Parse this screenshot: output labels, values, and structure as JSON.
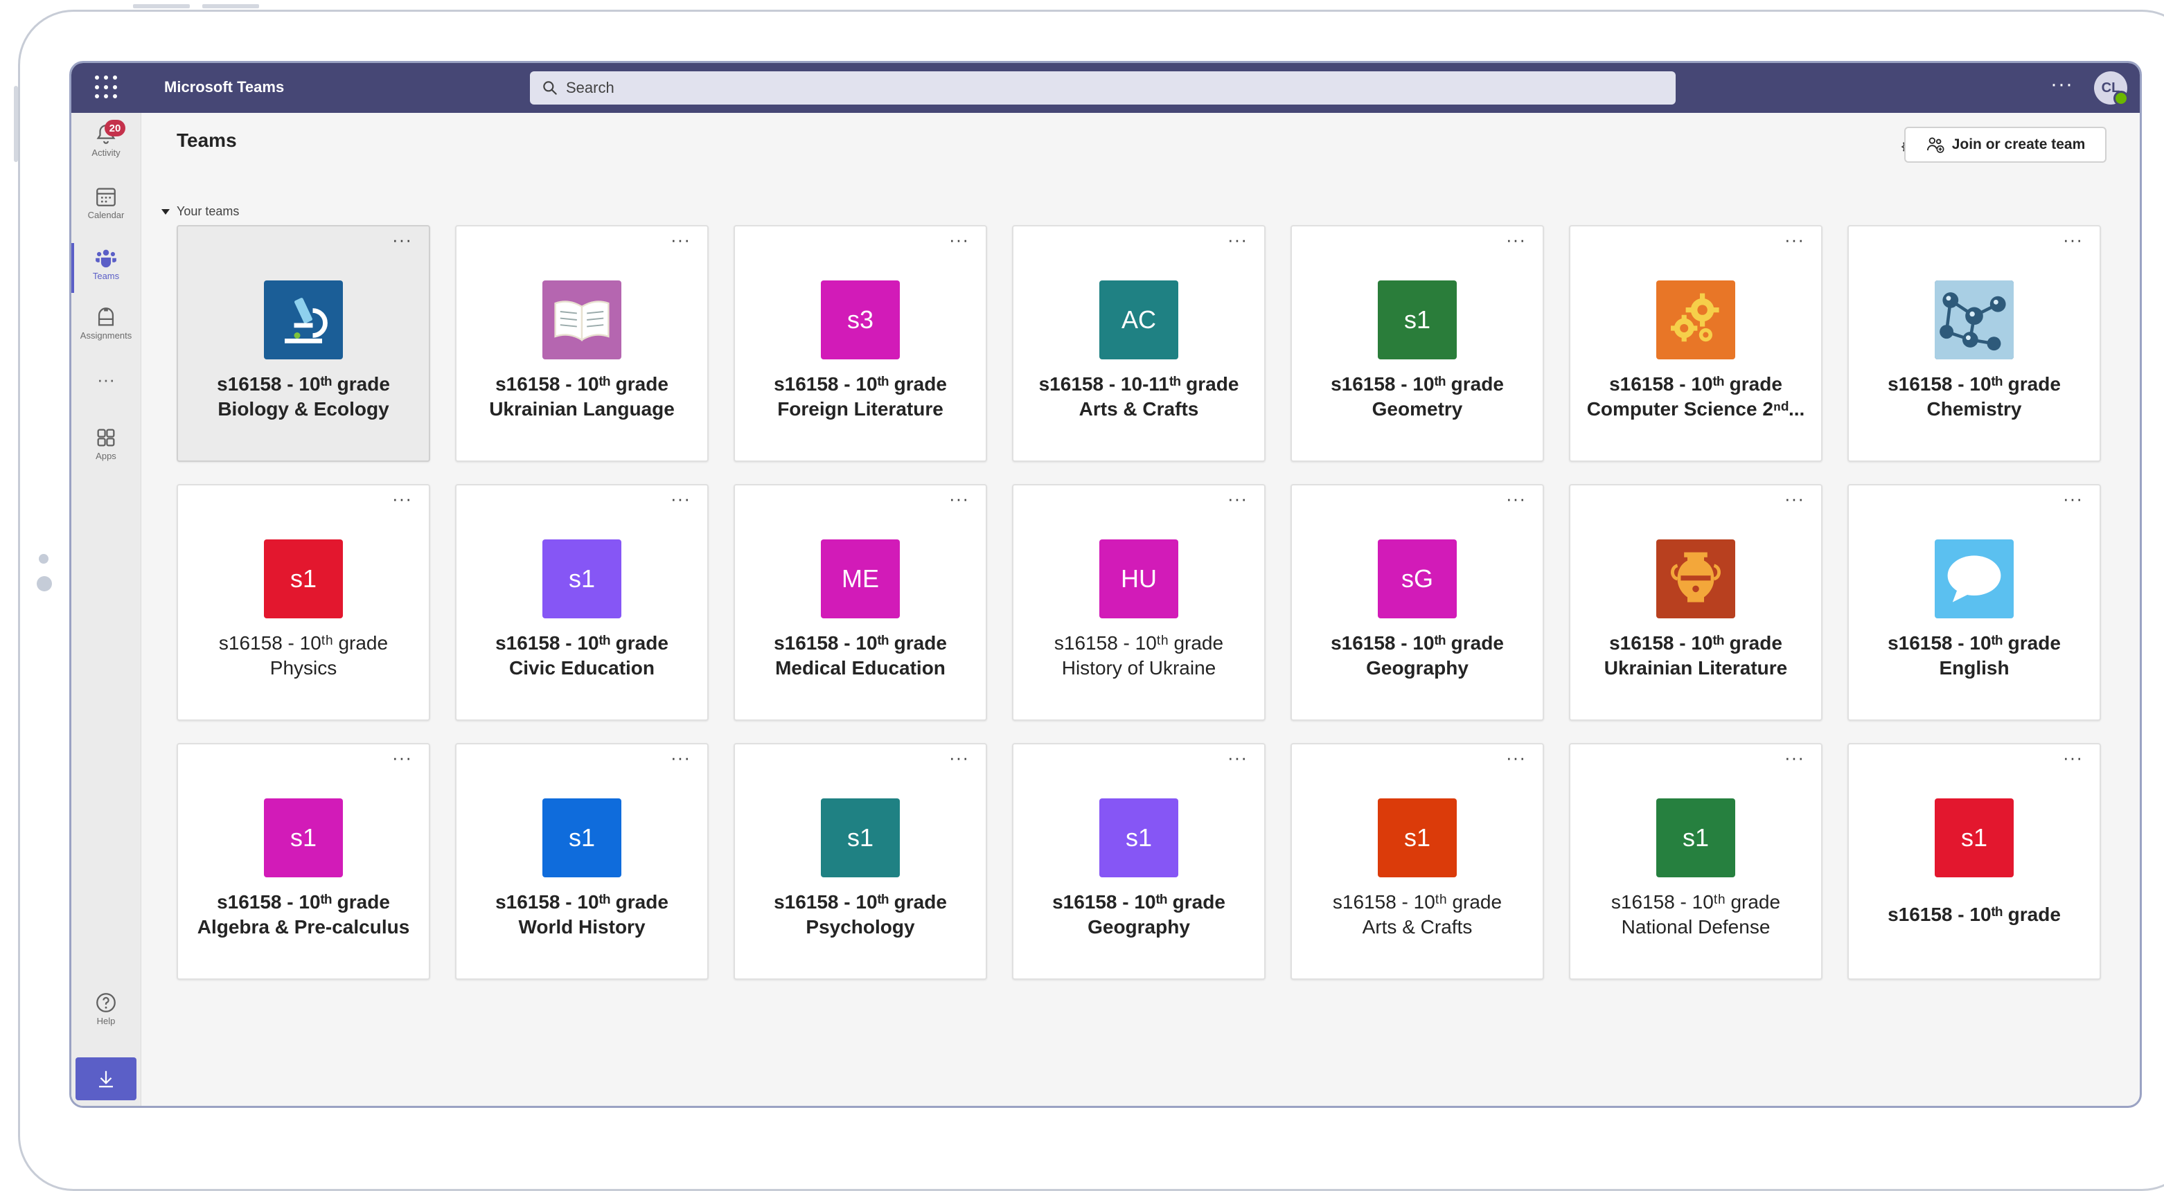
{
  "app": {
    "name": "Microsoft Teams",
    "avatar_initials": "CL"
  },
  "search": {
    "placeholder": "Search"
  },
  "top_more": "···",
  "rail": {
    "activity": {
      "label": "Activity",
      "badge": "20"
    },
    "calendar": {
      "label": "Calendar"
    },
    "teams": {
      "label": "Teams"
    },
    "assignments": {
      "label": "Assignments"
    },
    "more": "···",
    "apps": {
      "label": "Apps"
    },
    "help": {
      "label": "Help"
    }
  },
  "header": {
    "title": "Teams",
    "join_label": "Join or create team"
  },
  "section": {
    "label": "Your teams"
  },
  "card_more": "···",
  "teams": [
    {
      "line1": "s16158 - 10ᵗʰ grade",
      "line2": "Biology & Ecology",
      "tile": "",
      "color": "#1b5e97",
      "icon": "microscope-icon",
      "bold": true,
      "hover": true
    },
    {
      "line1": "s16158 - 10ᵗʰ grade",
      "line2": "Ukrainian Language",
      "tile": "",
      "color": "#b566b0",
      "icon": "book-icon",
      "bold": true
    },
    {
      "line1": "s16158 - 10ᵗʰ grade",
      "line2": "Foreign Literature",
      "tile": "s3",
      "color": "#d21bb8",
      "bold": true
    },
    {
      "line1": "s16158 - 10-11ᵗʰ grade",
      "line2": "Arts & Crafts",
      "tile": "AC",
      "color": "#1f8183",
      "bold": true
    },
    {
      "line1": "s16158 - 10ᵗʰ grade",
      "line2": "Geometry",
      "tile": "s1",
      "color": "#2a7d3a",
      "bold": true
    },
    {
      "line1": "s16158 - 10ᵗʰ grade",
      "line2": "Computer Science  2ⁿᵈ...",
      "tile": "",
      "color": "#e87627",
      "icon": "gears-icon",
      "bold": true
    },
    {
      "line1": "s16158 - 10ᵗʰ grade",
      "line2": "Chemistry",
      "tile": "",
      "color": "#3d6d93",
      "icon": "molecule-icon",
      "bold": true
    },
    {
      "line1": "s16158 - 10ᵗʰ grade",
      "line2": "Physics",
      "tile": "s1",
      "color": "#e3172e",
      "bold": false
    },
    {
      "line1": "s16158 - 10ᵗʰ grade",
      "line2": "Civic Education",
      "tile": "s1",
      "color": "#8656f5",
      "bold": true
    },
    {
      "line1": "s16158 - 10ᵗʰ grade",
      "line2": "Medical Education",
      "tile": "ME",
      "color": "#d21bb8",
      "bold": true
    },
    {
      "line1": "s16158 - 10ᵗʰ grade",
      "line2": "History of Ukraine",
      "tile": "HU",
      "color": "#d21bb8",
      "bold": false
    },
    {
      "line1": "s16158 - 10ᵗʰ grade",
      "line2": "Geography",
      "tile": "sG",
      "color": "#d21bb8",
      "bold": true
    },
    {
      "line1": "s16158 - 10ᵗʰ grade",
      "line2": "Ukrainian Literature",
      "tile": "",
      "color": "#b8401f",
      "icon": "amphora-icon",
      "bold": true
    },
    {
      "line1": "s16158 - 10ᵗʰ grade",
      "line2": "English",
      "tile": "",
      "color": "#5bc0f0",
      "icon": "speech-bubble-icon",
      "bold": true
    },
    {
      "line1": "s16158 - 10ᵗʰ grade",
      "line2": "Algebra & Pre-calculus",
      "tile": "s1",
      "color": "#d21bb8",
      "bold": true
    },
    {
      "line1": "s16158 - 10ᵗʰ grade",
      "line2": "World History",
      "tile": "s1",
      "color": "#0f6cdc",
      "bold": true
    },
    {
      "line1": "s16158 - 10ᵗʰ grade",
      "line2": "Psychology",
      "tile": "s1",
      "color": "#1f8183",
      "bold": true
    },
    {
      "line1": "s16158 - 10ᵗʰ grade",
      "line2": "Geography",
      "tile": "s1",
      "color": "#8656f5",
      "bold": true
    },
    {
      "line1": "s16158 - 10ᵗʰ grade",
      "line2": "Arts & Crafts",
      "tile": "s1",
      "color": "#db3b0a",
      "bold": false
    },
    {
      "line1": "s16158 - 10ᵗʰ grade",
      "line2": "National Defense",
      "tile": "s1",
      "color": "#26803f",
      "bold": false
    },
    {
      "line1": "s16158 - 10ᵗʰ grade",
      "line2": "",
      "tile": "s1",
      "color": "#e3172e",
      "bold": true
    }
  ]
}
